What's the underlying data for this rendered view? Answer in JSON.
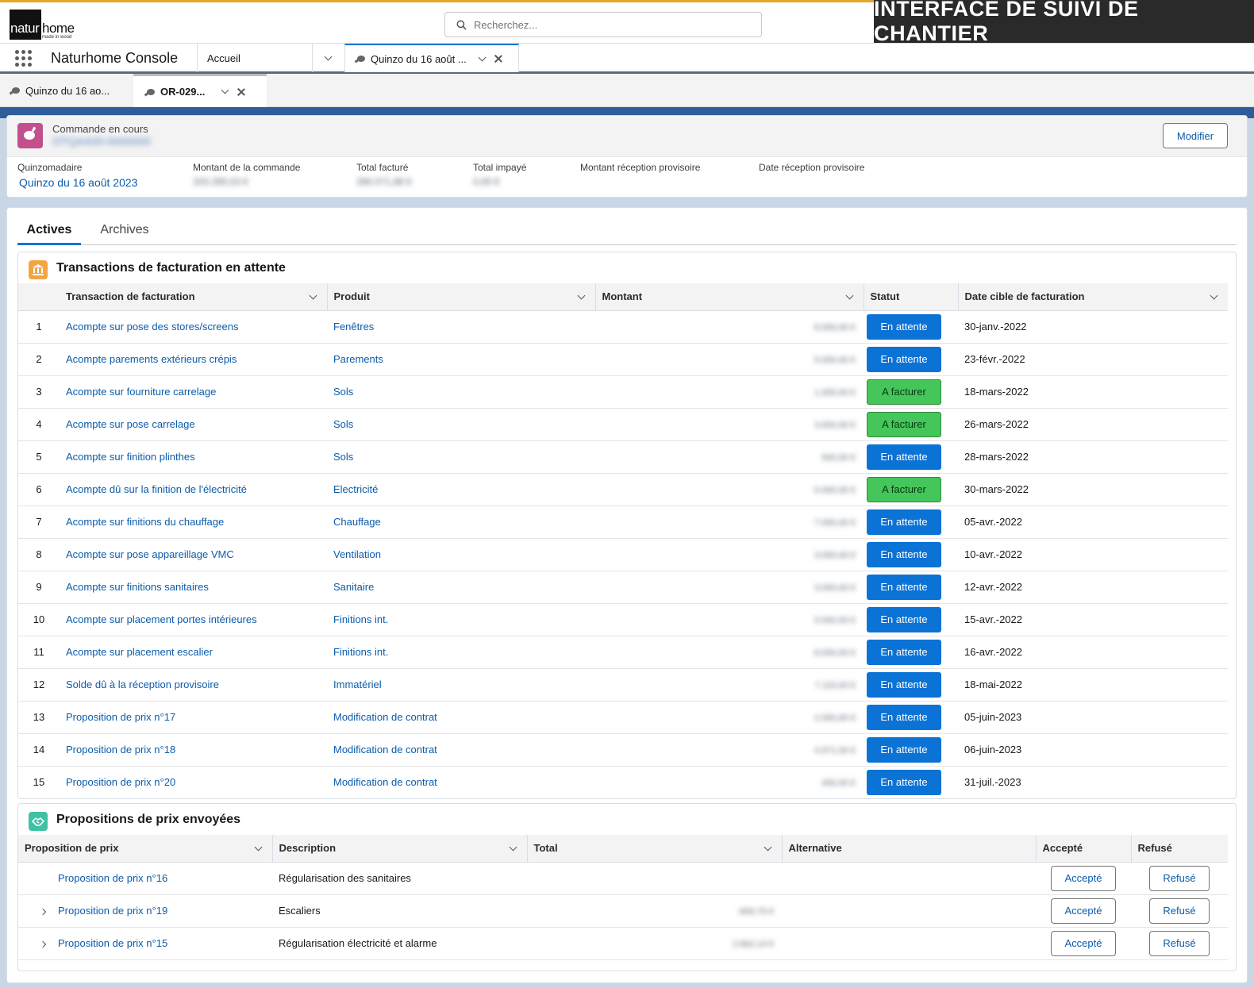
{
  "banner": "INTERFACE DE SUIVI DE CHANTIER",
  "logo": {
    "part1": "natur",
    "part2": "home",
    "tagline": "made in wood"
  },
  "search": {
    "placeholder": "Recherchez..."
  },
  "nav": {
    "app_name": "Naturhome Console",
    "tabs": [
      {
        "label": "Accueil"
      },
      {
        "label": "Quinzo du 16 août ..."
      }
    ]
  },
  "subtabs": [
    {
      "label": "Quinzo du 16 ao..."
    },
    {
      "label": "OR-029..."
    }
  ],
  "record": {
    "object_label": "Commande en cours",
    "name": "OTQAA00-0000000",
    "edit_label": "Modifier",
    "fields": [
      {
        "label": "Quinzomadaire",
        "value": "Quinzo du 16 août 2023"
      },
      {
        "label": "Montant de la commande",
        "value": "333.285,53 €"
      },
      {
        "label": "Total facturé",
        "value": "280.071,88 €"
      },
      {
        "label": "Total impayé",
        "value": "0,00 €"
      },
      {
        "label": "Montant réception provisoire",
        "value": ""
      },
      {
        "label": "Date réception provisoire",
        "value": ""
      }
    ]
  },
  "tabs": {
    "active": "Actives",
    "inactive": "Archives"
  },
  "billing": {
    "title": "Transactions de facturation en attente",
    "columns": [
      "Transaction de facturation",
      "Produit",
      "Montant",
      "Statut",
      "Date cible de facturation"
    ],
    "rows": [
      {
        "n": "1",
        "name": "Acompte sur pose des stores/screens",
        "product": "Fenêtres",
        "amount": "8.000,00 €",
        "status": "En attente",
        "status_kind": "wait",
        "date": "30-janv.-2022"
      },
      {
        "n": "2",
        "name": "Acompte parements extérieurs crépis",
        "product": "Parements",
        "amount": "5.000,00 €",
        "status": "En attente",
        "status_kind": "wait",
        "date": "23-févr.-2022"
      },
      {
        "n": "3",
        "name": "Acompte sur fourniture carrelage",
        "product": "Sols",
        "amount": "1.000,00 €",
        "status": "A facturer",
        "status_kind": "bill",
        "date": "18-mars-2022"
      },
      {
        "n": "4",
        "name": "Acompte sur pose carrelage",
        "product": "Sols",
        "amount": "3.000,00 €",
        "status": "A facturer",
        "status_kind": "bill",
        "date": "26-mars-2022"
      },
      {
        "n": "5",
        "name": "Acompte sur finition plinthes",
        "product": "Sols",
        "amount": "500,00 €",
        "status": "En attente",
        "status_kind": "wait",
        "date": "28-mars-2022"
      },
      {
        "n": "6",
        "name": "Acompte dû sur la finition de l'électricité",
        "product": "Electricité",
        "amount": "5.000,00 €",
        "status": "A facturer",
        "status_kind": "bill",
        "date": "30-mars-2022"
      },
      {
        "n": "7",
        "name": "Acompte sur finitions du chauffage",
        "product": "Chauffage",
        "amount": "7.000,00 €",
        "status": "En attente",
        "status_kind": "wait",
        "date": "05-avr.-2022"
      },
      {
        "n": "8",
        "name": "Acompte sur pose appareillage VMC",
        "product": "Ventilation",
        "amount": "3.000,00 €",
        "status": "En attente",
        "status_kind": "wait",
        "date": "10-avr.-2022"
      },
      {
        "n": "9",
        "name": "Acompte sur finitions sanitaires",
        "product": "Sanitaire",
        "amount": "3.000,00 €",
        "status": "En attente",
        "status_kind": "wait",
        "date": "12-avr.-2022"
      },
      {
        "n": "10",
        "name": "Acompte sur placement portes intérieures",
        "product": "Finitions int.",
        "amount": "5.000,00 €",
        "status": "En attente",
        "status_kind": "wait",
        "date": "15-avr.-2022"
      },
      {
        "n": "11",
        "name": "Acompte sur placement escalier",
        "product": "Finitions int.",
        "amount": "8.000,00 €",
        "status": "En attente",
        "status_kind": "wait",
        "date": "16-avr.-2022"
      },
      {
        "n": "12",
        "name": "Solde dû à la réception provisoire",
        "product": "Immatériel",
        "amount": "7.115,00 €",
        "status": "En attente",
        "status_kind": "wait",
        "date": "18-mai-2022"
      },
      {
        "n": "13",
        "name": "Proposition de prix n°17",
        "product": "Modification de contrat",
        "amount": "2.000,00 €",
        "status": "En attente",
        "status_kind": "wait",
        "date": "05-juin-2023"
      },
      {
        "n": "14",
        "name": "Proposition de prix n°18",
        "product": "Modification de contrat",
        "amount": "4.971,00 €",
        "status": "En attente",
        "status_kind": "wait",
        "date": "06-juin-2023"
      },
      {
        "n": "15",
        "name": "Proposition de prix n°20",
        "product": "Modification de contrat",
        "amount": "450,00 €",
        "status": "En attente",
        "status_kind": "wait",
        "date": "31-juil.-2023"
      }
    ]
  },
  "quotes": {
    "title": "Propositions de prix envoyées",
    "columns": [
      "Proposition de prix",
      "Description",
      "Total",
      "Alternative",
      "Accepté",
      "Refusé"
    ],
    "accept_label": "Accepté",
    "refuse_label": "Refusé",
    "rows": [
      {
        "name": "Proposition de prix n°16",
        "description": "Régularisation des sanitaires",
        "total": "",
        "expandable": false
      },
      {
        "name": "Proposition de prix n°19",
        "description": "Escaliers",
        "total": "-909,75 €",
        "expandable": true
      },
      {
        "name": "Proposition de prix n°15",
        "description": "Régularisation électricité et alarme",
        "total": "2.662,14 €",
        "expandable": true
      }
    ]
  }
}
